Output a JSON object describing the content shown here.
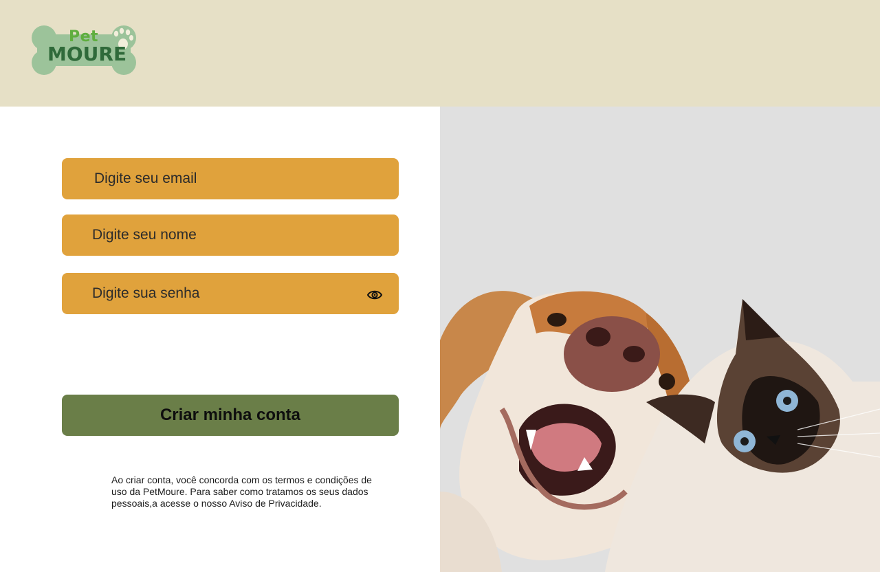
{
  "header": {
    "logo": {
      "word_top": "Pet",
      "word_bottom": "MOURE"
    }
  },
  "form": {
    "email_placeholder": "Digite seu email",
    "name_placeholder": "Digite seu nome",
    "password_placeholder": "Digite sua senha",
    "submit_label": "Criar minha conta",
    "terms_text": "Ao criar conta, você concorda com os termos e condições de uso da PetMoure. Para saber como tratamos os seus dados pessoais,a acesse o nosso Aviso de Privacidade."
  },
  "icons": {
    "password_toggle": "eye-icon"
  },
  "colors": {
    "header_bg": "#e6e0c6",
    "field_bg": "#e0a23c",
    "button_bg": "#6a7e48",
    "photo_bg": "#e0e0e0"
  }
}
